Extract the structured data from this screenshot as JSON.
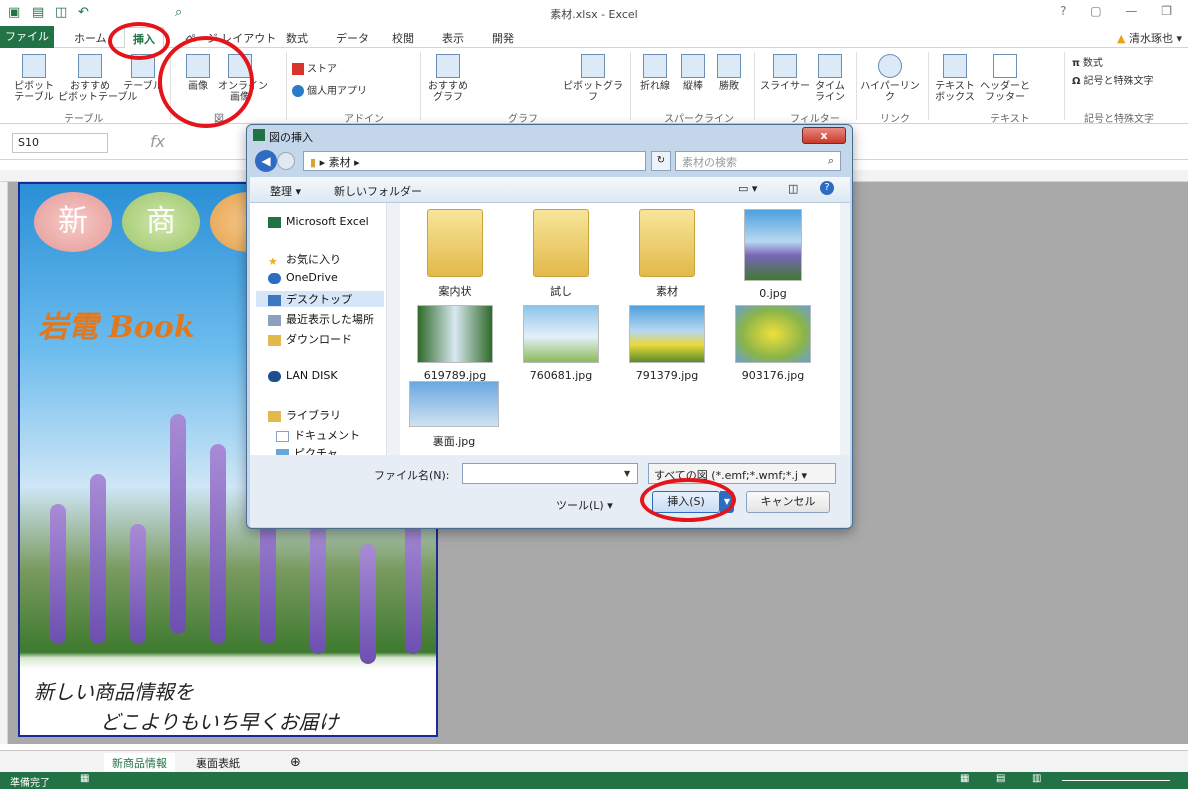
{
  "window": {
    "title": "素材.xlsx - Excel",
    "controls": "?  ▢  —  ❐",
    "user": "清水琢也 ▾",
    "warning_icon": "warning-icon"
  },
  "tabs": [
    "ファイル",
    "ホーム",
    "挿入",
    "ページ レイアウト",
    "数式",
    "データ",
    "校閲",
    "表示",
    "開発"
  ],
  "ribbon": {
    "pivot": "ピボット\nテーブル",
    "recommended_pivot": "おすすめ\nピボットテーブル",
    "table": "テーブル",
    "group_table": "テーブル",
    "picture": "画像",
    "online_picture": "オンライン\n画像",
    "group_figure": "図",
    "store": "ストア",
    "my_apps": "個人用アプリ",
    "group_addin": "アドイン",
    "recommended_chart": "おすすめ\nグラフ",
    "pivot_chart": "ピボットグラフ",
    "group_chart": "グラフ",
    "line": "折れ線",
    "column": "縦棒",
    "win_loss": "勝敗",
    "group_sparkline": "スパークライン",
    "slicer": "スライサー",
    "timeline": "タイム\nライン",
    "group_filter": "フィルター",
    "hyperlink": "ハイパーリンク",
    "group_link": "リンク",
    "textbox": "テキスト\nボックス",
    "header_footer": "ヘッダーと\nフッター",
    "group_text": "テキスト",
    "equation": "数式",
    "symbol": "記号と特殊文字",
    "group_symbols": "記号と特殊文字",
    "equation_glyph": "π",
    "omega_glyph": "Ω"
  },
  "formula_bar": {
    "name_box": "S10",
    "fx": "fx"
  },
  "poster": {
    "bubble1": "新",
    "bubble2": "商",
    "brand": "岩電 Book",
    "tagline1": "新しい商品情報を",
    "tagline2": "どこよりもいち早くお届け"
  },
  "sheet_tabs": [
    "新商品情報",
    "裏面表紙"
  ],
  "status": {
    "ready": "準備完了"
  },
  "dialog": {
    "title": "図の挿入",
    "close": "x",
    "address": "▸ 素材 ▸",
    "search_placeholder": "素材の検索",
    "organize": "整理 ▾",
    "new_folder": "新しいフォルダー",
    "nav": [
      "Microsoft Excel",
      "お気に入り",
      "OneDrive",
      "デスクトップ",
      "最近表示した場所",
      "ダウンロード",
      "LAN DISK",
      "ライブラリ",
      "ドキュメント",
      "ピクチャ"
    ],
    "files": [
      "案内状",
      "試し",
      "素材",
      "0.jpg",
      "619789.jpg",
      "760681.jpg",
      "791379.jpg",
      "903176.jpg",
      "裏面.jpg"
    ],
    "filename_label": "ファイル名(N):",
    "filetype": "すべての図 (*.emf;*.wmf;*.j ▾",
    "tools": "ツール(L)  ▾",
    "insert": "挿入(S)",
    "cancel": "キャンセル"
  },
  "colors": {
    "excel_green": "#217346",
    "annotation_red": "#e4141b"
  }
}
